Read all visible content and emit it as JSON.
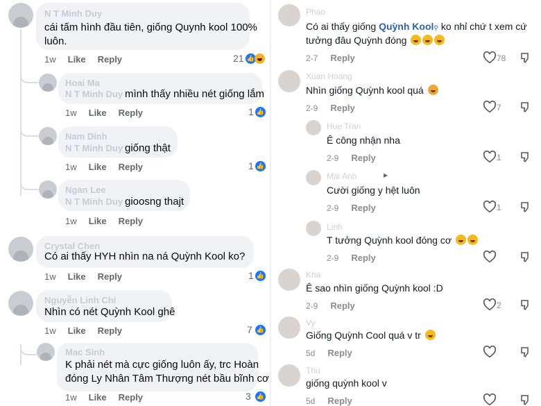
{
  "left_panel": {
    "comments": [
      {
        "name": "N T Minh Duy",
        "text_line1": "cái tấm hình đầu tiên, giống Quynh kool 100%",
        "text_line2": "luôn.",
        "time": "1w",
        "like": "Like",
        "reply": "Reply",
        "count": "21",
        "reactions": [
          "like",
          "haha"
        ]
      },
      {
        "name": "Hoai Ma",
        "mention": "N T Minh Duy",
        "text": "mình thấy nhiều nét giống lắm",
        "time": "1w",
        "like": "Like",
        "reply": "Reply",
        "count": "1",
        "reactions": [
          "like"
        ]
      },
      {
        "name": "Nam Dinh",
        "mention": "N T Minh Duy",
        "text": "giống thật",
        "time": "1w",
        "like": "Like",
        "reply": "Reply",
        "count": "1",
        "reactions": [
          "like"
        ]
      },
      {
        "name": "Ngan Lee",
        "mention": "N T Minh Duy",
        "text": "gioosng thajt",
        "time": "1w",
        "like": "Like",
        "reply": "Reply",
        "count": "",
        "reactions": []
      },
      {
        "name": "Crystal Chen",
        "text": "Có ai thấy HYH nhìn na ná Quỳnh Kool ko?",
        "time": "1w",
        "like": "Like",
        "reply": "Reply",
        "count": "1",
        "reactions": [
          "like"
        ]
      },
      {
        "name": "Nguyễn Linh Chi",
        "text": "Nhìn có nét Quỳnh Kool ghê",
        "time": "1w",
        "like": "Like",
        "reply": "Reply",
        "count": "7",
        "reactions": [
          "like"
        ]
      },
      {
        "name": "Mac Sinh",
        "text_line1": "K phải nét mà cực giống luôn ấy, trc Hoàn",
        "text_line2": "đóng Ly Nhân Tâm Thượng nét bầu bĩnh cơ",
        "time": "1w",
        "like": "Like",
        "reply": "Reply",
        "count": "3",
        "reactions": [
          "like"
        ]
      }
    ]
  },
  "right_panel": {
    "comments": [
      {
        "name": "Phao",
        "text_pre": "Có ai thấy giống ",
        "keyword": "Quỳnh Kool",
        "text_post": " ko nhỉ chứ t xem cứ",
        "text_line2": "tưởng đâu Quỳnh đóng",
        "emojis": 3,
        "date": "2-7",
        "reply": "Reply",
        "likes": "78"
      },
      {
        "name": "Xuan Hoang",
        "text": "Nhìn giống Quỳnh kool quá",
        "emojis": 1,
        "date": "2-9",
        "reply": "Reply",
        "likes": "7"
      },
      {
        "name": "Hue Tran",
        "text": "Ê công nhận nha",
        "emojis": 0,
        "date": "2-9",
        "reply": "Reply",
        "likes": "1"
      },
      {
        "name": "Mai Anh",
        "text": "Cười giống y hệt luôn",
        "emojis": 0,
        "date": "2-9",
        "reply": "Reply",
        "likes": "1"
      },
      {
        "name": "Linh",
        "text": "T tưởng Quỳnh kool đóng cơ",
        "emojis": 2,
        "date": "2-9",
        "reply": "Reply",
        "likes": ""
      },
      {
        "name": "Kha",
        "text": "Ê sao nhìn giống Quỳnh kool :D",
        "emojis": 0,
        "date": "2-9",
        "reply": "Reply",
        "likes": "2"
      },
      {
        "name": "Vy",
        "text": "Giống Quỳnh Cool quá v tr",
        "emojis": 1,
        "date": "5d",
        "reply": "Reply",
        "likes": ""
      },
      {
        "name": "Thu",
        "text": "giống quỳnh kool v",
        "emojis": 0,
        "date": "5d",
        "reply": "Reply",
        "likes": ""
      }
    ]
  },
  "colors": {
    "fb_bubble": "#f0f2f5",
    "fb_like": "#1877f2",
    "tt_keyword": "#2f5fb6",
    "meta": "#65676b"
  }
}
